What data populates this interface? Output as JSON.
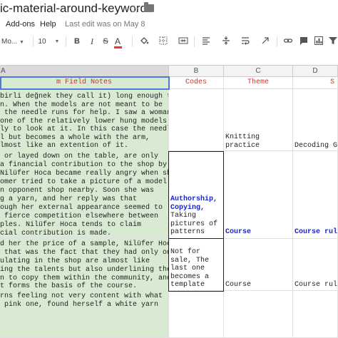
{
  "window": {
    "title": "ic-material-around-keywords",
    "star_icon": "star-outline-icon",
    "folder_icon": "folder-icon"
  },
  "menu": {
    "addons": "Add-ons",
    "help": "Help",
    "last_edit": "Last edit was on May 8"
  },
  "toolbar": {
    "font": "Mo...",
    "size": "10",
    "bold": "B",
    "italic": "I",
    "strike": "S",
    "text_color": "A",
    "text_color_bar": "#e53935",
    "icons": [
      "fill-color-icon",
      "borders-icon",
      "merge-cells-icon",
      "align-icon",
      "valign-icon",
      "wrap-icon",
      "link-icon",
      "comment-icon",
      "chart-icon",
      "filter-icon"
    ]
  },
  "columns": {
    "a": "A",
    "b": "B",
    "c": "C",
    "d": "D"
  },
  "header": {
    "a": "m Field Notes",
    "b": "Codes",
    "c": "Theme",
    "d": "S"
  },
  "rows": [
    {
      "a": [
        "birli değnek they call it) long enough to",
        "n. When the models are not meant to be",
        " the needle runs for help. I saw a woman",
        "one of the relatively lower hung models",
        "ly to look at it. In this case the needle",
        "l but becomes a whole with the arm,",
        "lmost like an extention of it."
      ],
      "b": [],
      "c": [
        "Knitting",
        "practice"
      ],
      "d": "Decoding Ge"
    },
    {
      "a": [
        " or layed down on the table, are only",
        "a financial contribution to the shop by",
        "Nilüfer Hoca became really angry when she",
        "omer tried to take a picture of a model",
        "n opponent shop nearby. Soon she was",
        "g a yarn, and her reply was that",
        "ough her external appearance seemed to",
        " fierce competition elsewhere between",
        "ples. Nilüfer Hoca tends to claim",
        "cial contribution is made."
      ],
      "b_bold": [
        "Authorship,",
        "Copying,"
      ],
      "b": [
        "Taking",
        "pictures of",
        "patterns"
      ],
      "c": "Course",
      "d": "Course rule"
    },
    {
      "a": [
        "d her the price of a sample, Nilüfer Hoca",
        " that was the fact that they had only one",
        "ulating in the shop are almost like",
        "ing the talents but also underlining the",
        "n to copy them within the community, and",
        "t forms the basis of the course."
      ],
      "b": [
        "Not for",
        "sale, The",
        "last one",
        "becomes a",
        "template"
      ],
      "c": "Course",
      "d": "Course rule"
    },
    {
      "a": [
        "rns feeling not very content with what",
        " pink one, found herself a white yarn"
      ],
      "b": [],
      "c": "",
      "d": ""
    }
  ]
}
